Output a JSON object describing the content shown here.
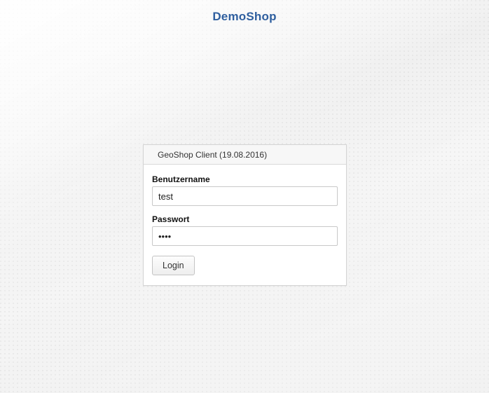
{
  "header": {
    "title": "DemoShop"
  },
  "login": {
    "panel_title": "GeoShop Client (19.08.2016)",
    "username_label": "Benutzername",
    "username_value": "test",
    "password_label": "Passwort",
    "password_value": "••••",
    "login_button": "Login"
  }
}
